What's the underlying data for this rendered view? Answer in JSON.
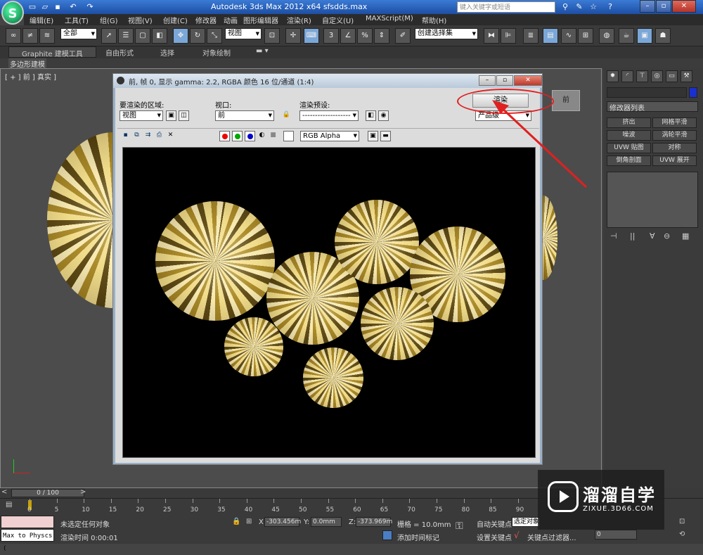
{
  "app": {
    "title": "Autodesk 3ds Max  2012 x64     sfsdds.max",
    "search_placeholder": "键入关键字或短语",
    "logo_letter": "S"
  },
  "menubar": {
    "items": [
      "编辑(E)",
      "工具(T)",
      "组(G)",
      "视图(V)",
      "创建(C)",
      "修改器",
      "动画",
      "图形编辑器",
      "渲染(R)",
      "自定义(U)",
      "MAXScript(M)",
      "帮助(H)"
    ]
  },
  "toolbar": {
    "selection_filter": "全部",
    "ref_coord": "视图",
    "named_selection": "创建选择集"
  },
  "ribbon": {
    "tabs": [
      "Graphite 建模工具",
      "自由形式",
      "选择",
      "对象绘制"
    ],
    "sub_label": "多边形建模"
  },
  "viewport": {
    "label": "[ + ] 前 ] 真实 ]"
  },
  "render_window": {
    "title": "前, 帧 0, 显示 gamma: 2.2, RGBA 颜色 16 位/通道 (1:4)",
    "area_label": "要渲染的区域:",
    "area_value": "视图",
    "viewport_label": "视口:",
    "viewport_value": "前",
    "preset_label": "渲染预设:",
    "preset_value": "-------------------",
    "render_button": "渲染",
    "product_value": "产品级",
    "channel_value": "RGB Alpha"
  },
  "command_panel": {
    "modifier_list": "修改器列表",
    "buttons": [
      "挤出",
      "网格平滑",
      "噪波",
      "涡轮平滑",
      "UVW 贴图",
      "对称",
      "倒角剖面",
      "UVW 展开"
    ]
  },
  "timeline": {
    "frame_label": "0 / 100",
    "ticks": [
      "0",
      "5",
      "10",
      "15",
      "20",
      "25",
      "30",
      "35",
      "40",
      "45",
      "50",
      "55",
      "60",
      "65",
      "70",
      "75",
      "80",
      "85",
      "90"
    ]
  },
  "statusbar": {
    "maxscript_text": "Max to Physcs (",
    "status": "未选定任何对象",
    "render_time": "渲染时间  0:00:01",
    "x_label": "X:",
    "x_value": "-303.456m",
    "y_label": "Y:",
    "y_value": "0.0mm",
    "z_label": "Z:",
    "z_value": "-373.969m",
    "grid": "栅格 = 10.0mm",
    "add_time_tag": "添加时间标记",
    "auto_key": "自动关键点",
    "selected": "选定对象",
    "set_key": "设置关键点",
    "key_filter": "关键点过滤器...",
    "frame_value": "0"
  },
  "watermark": {
    "title": "溜溜自学",
    "url": "ZIXUE.3D66.COM"
  },
  "colors": {
    "annotation": "#e02020",
    "title_blue": "#2a5fb8"
  }
}
